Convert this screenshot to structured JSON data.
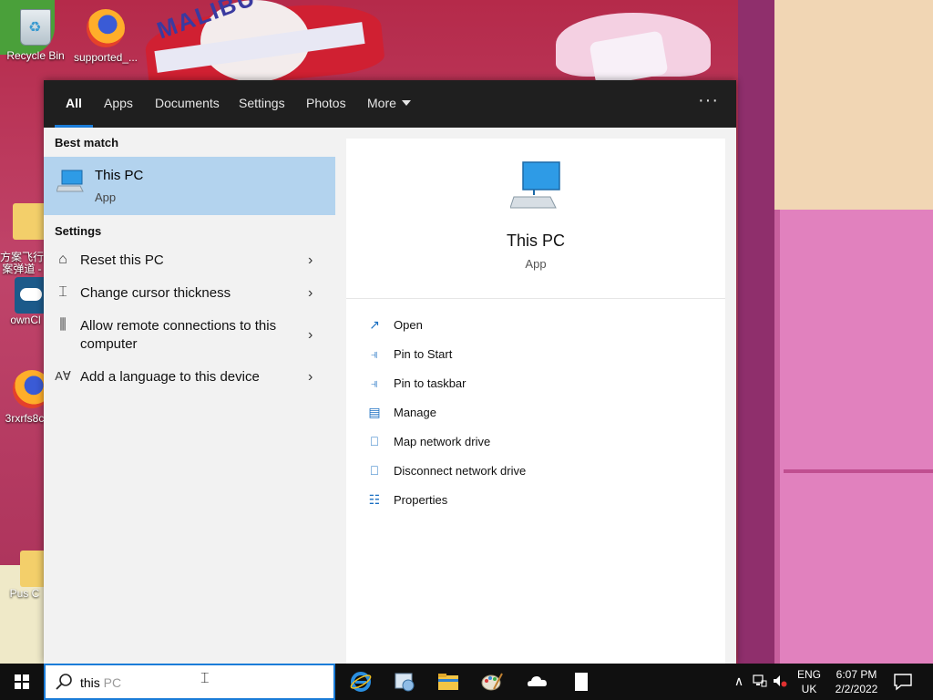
{
  "desktop": {
    "icons": [
      {
        "label": "Recycle Bin",
        "icon": "recycle-bin-icon"
      },
      {
        "label": "supported_...",
        "icon": "firefox-icon"
      },
      {
        "label": "方案飞行\n案弹道 -",
        "icon": "folder-icon"
      },
      {
        "label": "ownCl",
        "icon": "owncloud-icon"
      },
      {
        "label": "3rxrfs8c",
        "icon": "firefox-icon"
      },
      {
        "label": "Pus C",
        "icon": "folder-icon"
      }
    ],
    "wallpaper_text": "MALIBU"
  },
  "search_panel": {
    "tabs": [
      {
        "label": "All",
        "active": true
      },
      {
        "label": "Apps",
        "active": false
      },
      {
        "label": "Documents",
        "active": false
      },
      {
        "label": "Settings",
        "active": false
      },
      {
        "label": "Photos",
        "active": false
      },
      {
        "label": "More",
        "active": false
      }
    ],
    "overflow": "···",
    "best_match_label": "Best match",
    "best_match": {
      "title": "This PC",
      "subtitle": "App",
      "icon": "this-pc-icon"
    },
    "settings_label": "Settings",
    "settings_items": [
      {
        "label": "Reset this PC",
        "icon": "reset-pc-icon"
      },
      {
        "label": "Change cursor thickness",
        "icon": "cursor-icon"
      },
      {
        "label": "Allow remote connections to this computer",
        "icon": "remote-settings-icon"
      },
      {
        "label": "Add a language to this device",
        "icon": "language-icon"
      }
    ],
    "detail": {
      "title": "This PC",
      "subtitle": "App",
      "actions": [
        {
          "label": "Open",
          "icon": "open-icon"
        },
        {
          "label": "Pin to Start",
          "icon": "pin-icon"
        },
        {
          "label": "Pin to taskbar",
          "icon": "pin-icon"
        },
        {
          "label": "Manage",
          "icon": "manage-icon"
        },
        {
          "label": "Map network drive",
          "icon": "map-drive-icon"
        },
        {
          "label": "Disconnect network drive",
          "icon": "disconnect-drive-icon"
        },
        {
          "label": "Properties",
          "icon": "properties-icon"
        }
      ]
    }
  },
  "taskbar": {
    "search": {
      "typed": "this",
      "suggestion": " PC"
    },
    "apps": [
      "internet-explorer-icon",
      "control-panel-icon",
      "file-explorer-icon",
      "paint-icon",
      "onedrive-icon",
      "document-icon"
    ],
    "language": {
      "line1": "ENG",
      "line2": "UK"
    },
    "clock": {
      "time": "6:07 PM",
      "date": "2/2/2022"
    }
  },
  "colors": {
    "accent": "#1a7cd8",
    "selection": "#b3d3ee",
    "tabbar": "#1f1f1f",
    "taskbar": "#101010"
  }
}
